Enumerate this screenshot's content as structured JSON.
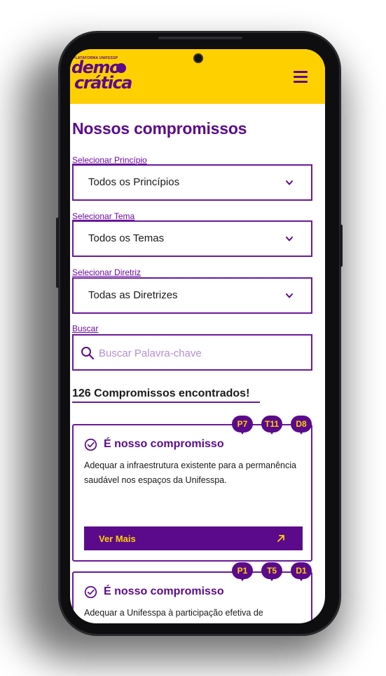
{
  "header": {
    "logo_top_text": "PLATAFORMA UNIFESSP",
    "logo_line1": "demo",
    "logo_line2": "crática",
    "menu_icon": "hamburger-menu-icon"
  },
  "page": {
    "title": "Nossos compromissos"
  },
  "filters": {
    "principio": {
      "label": "Selecionar Princípio",
      "value": "Todos os Princípios"
    },
    "tema": {
      "label": "Selecionar Tema",
      "value": "Todos os Temas"
    },
    "diretriz": {
      "label": "Selecionar Diretriz",
      "value": "Todas as Diretrizes"
    },
    "buscar": {
      "label": "Buscar",
      "placeholder": "Buscar Palavra-chave"
    }
  },
  "results": {
    "count_text": "126 Compromissos encontrados!"
  },
  "cards": [
    {
      "badges": [
        "P7",
        "T11",
        "D8"
      ],
      "title": "É nosso compromisso",
      "text": "Adequar a infraestrutura existente para a permanência saudável nos espaços da Unifesspa.",
      "button_label": "Ver Mais"
    },
    {
      "badges": [
        "P1",
        "T5",
        "D1"
      ],
      "title": "É nosso compromisso",
      "text": "Adequar a Unifesspa à participação efetiva de"
    }
  ],
  "colors": {
    "brand_purple": "#5b0a8c",
    "brand_yellow": "#ffd000",
    "border_purple": "#6a1b9a"
  }
}
